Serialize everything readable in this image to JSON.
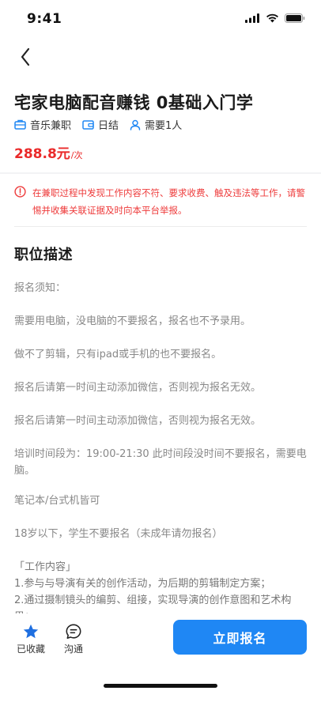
{
  "status_bar": {
    "time": "9:41"
  },
  "job": {
    "title": "宅家电脑配音赚钱 0基础入门学",
    "tags": [
      {
        "icon": "briefcase-icon",
        "label": "音乐兼职"
      },
      {
        "icon": "wallet-icon",
        "label": "日结"
      },
      {
        "icon": "person-icon",
        "label": "需要1人"
      }
    ],
    "salary": {
      "amount": "288.8元",
      "unit": "/次"
    }
  },
  "warning": {
    "icon": "alert-circle-icon",
    "text": "在兼职过程中发现工作内容不符、要求收费、触及违法等工作，请警惕并收集关联证据及时向本平台举报。"
  },
  "description": {
    "title": "职位描述",
    "paragraphs": [
      "报名须知：",
      "需要用电脑，没电脑的不要报名，报名也不予录用。",
      "做不了剪辑，只有ipad或手机的也不要报名。",
      "报名后请第一时间主动添加微信，否则视为报名无效。",
      "报名后请第一时间主动添加微信，否则视为报名无效。",
      "培训时间段为：19:00-21:30 此时间段没时间不要报名，需要电脑。",
      "笔记本/台式机皆可",
      "18岁以下，学生不要报名（未成年请勿报名）",
      "「工作内容」\n1.参与与导演有关的创作活动，为后期的剪辑制定方案；\n2.通过摄制镜头的编剪、组接，实现导演的创作意图和艺术构思；"
    ]
  },
  "bottom_bar": {
    "favorite_label": "已收藏",
    "chat_label": "沟通",
    "apply_label": "立即报名"
  },
  "colors": {
    "accent": "#1f87f4",
    "price": "#ea2a2a",
    "warning": "#ee3b3b",
    "star": "#1f6fe0"
  }
}
